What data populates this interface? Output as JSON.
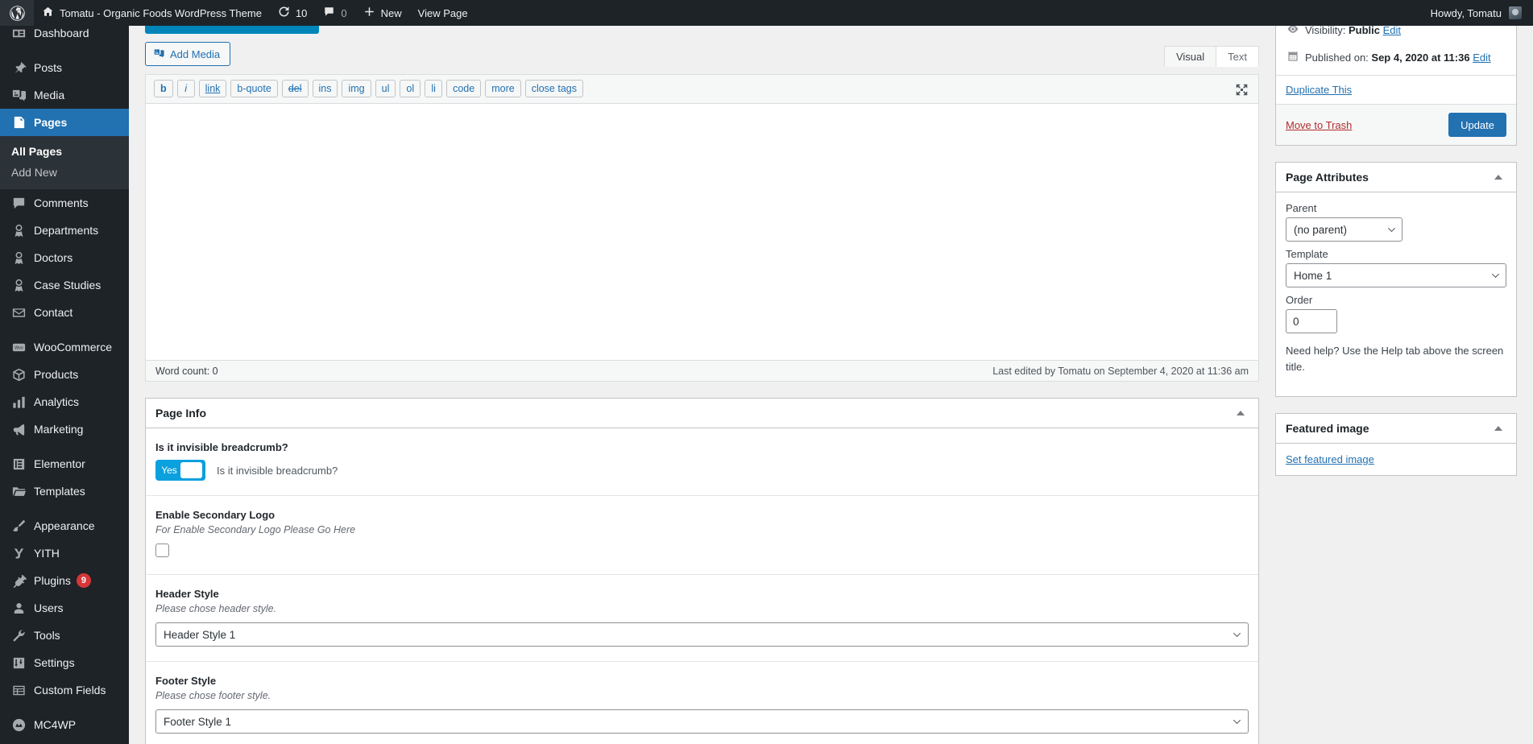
{
  "adminbar": {
    "logo_icon": "wordpress-logo-icon",
    "site_name": "Tomatu - Organic Foods WordPress Theme",
    "updates_count": "10",
    "comments_count": "0",
    "new_label": "New",
    "view_page_label": "View Page",
    "howdy": "Howdy, Tomatu"
  },
  "sidebar": {
    "items": [
      {
        "label": "Dashboard",
        "icon": "dashboard-icon",
        "current": false
      },
      {
        "label": "Posts",
        "icon": "pin-icon",
        "current": false
      },
      {
        "label": "Media",
        "icon": "media-icon",
        "current": false
      },
      {
        "label": "Pages",
        "icon": "pages-icon",
        "current": true
      },
      {
        "label": "Comments",
        "icon": "comment-icon",
        "current": false
      },
      {
        "label": "Departments",
        "icon": "awards-icon",
        "current": false
      },
      {
        "label": "Doctors",
        "icon": "awards-icon",
        "current": false
      },
      {
        "label": "Case Studies",
        "icon": "awards-icon",
        "current": false
      },
      {
        "label": "Contact",
        "icon": "email-icon",
        "current": false
      },
      {
        "label": "WooCommerce",
        "icon": "woocommerce-icon",
        "current": false
      },
      {
        "label": "Products",
        "icon": "products-icon",
        "current": false
      },
      {
        "label": "Analytics",
        "icon": "chart-bar-icon",
        "current": false
      },
      {
        "label": "Marketing",
        "icon": "megaphone-icon",
        "current": false
      },
      {
        "label": "Elementor",
        "icon": "elementor-icon",
        "current": false
      },
      {
        "label": "Templates",
        "icon": "folder-icon",
        "current": false
      },
      {
        "label": "Appearance",
        "icon": "paintbrush-icon",
        "current": false
      },
      {
        "label": "YITH",
        "icon": "yith-icon",
        "current": false
      },
      {
        "label": "Plugins",
        "icon": "plug-icon",
        "current": false,
        "badge": "9"
      },
      {
        "label": "Users",
        "icon": "user-icon",
        "current": false
      },
      {
        "label": "Tools",
        "icon": "wrench-icon",
        "current": false
      },
      {
        "label": "Settings",
        "icon": "settings-icon",
        "current": false
      },
      {
        "label": "Custom Fields",
        "icon": "custom-fields-icon",
        "current": false
      },
      {
        "label": "MC4WP",
        "icon": "mailchimp-icon",
        "current": false
      }
    ],
    "submenu": {
      "parent": "Pages",
      "items": [
        {
          "label": "All Pages",
          "current": true
        },
        {
          "label": "Add New",
          "current": false
        }
      ]
    }
  },
  "editor": {
    "add_media_label": "Add Media",
    "tabs": [
      {
        "label": "Visual",
        "active": true
      },
      {
        "label": "Text",
        "active": false
      }
    ],
    "quicktags": [
      "b",
      "i",
      "link",
      "b-quote",
      "del",
      "ins",
      "img",
      "ul",
      "ol",
      "li",
      "code",
      "more",
      "close tags"
    ],
    "content": "",
    "word_count_label": "Word count: 0",
    "last_edited": "Last edited by Tomatu on September 4, 2020 at 11:36 am",
    "fullscreen_icon": "fullscreen-icon"
  },
  "page_info": {
    "title": "Page Info",
    "collapse_icon": "triangle-up-icon",
    "fields": [
      {
        "type": "toggle",
        "label": "Is it invisible breadcrumb?",
        "toggle_label": "Yes",
        "inline_desc": "Is it invisible breadcrumb?",
        "color": "#0ba0de",
        "checked": true
      },
      {
        "type": "checkbox",
        "label": "Enable Secondary Logo",
        "desc": "For Enable Secondary Logo Please Go Here",
        "checked": false
      },
      {
        "type": "select",
        "label": "Header Style",
        "desc": "Please chose header style.",
        "value": "Header Style 1"
      },
      {
        "type": "select",
        "label": "Footer Style",
        "desc": "Please chose footer style.",
        "value": "Footer Style 1"
      }
    ]
  },
  "publish_box": {
    "visibility_icon": "eye-icon",
    "visibility_prefix": "Visibility:",
    "visibility_value": "Public",
    "visibility_edit": "Edit",
    "published_icon": "calendar-icon",
    "published_prefix": "Published on:",
    "published_value": "Sep 4, 2020 at 11:36",
    "published_edit": "Edit",
    "duplicate_label": "Duplicate This",
    "trash_label": "Move to Trash",
    "update_label": "Update",
    "primary_color": "#2271b1"
  },
  "page_attributes": {
    "title": "Page Attributes",
    "collapse_icon": "triangle-up-icon",
    "parent_label": "Parent",
    "parent_value": "(no parent)",
    "template_label": "Template",
    "template_value": "Home 1",
    "order_label": "Order",
    "order_value": "0",
    "help_note": "Need help? Use the Help tab above the screen title."
  },
  "featured_image": {
    "title": "Featured image",
    "collapse_icon": "triangle-up-icon",
    "set_label": "Set featured image"
  }
}
